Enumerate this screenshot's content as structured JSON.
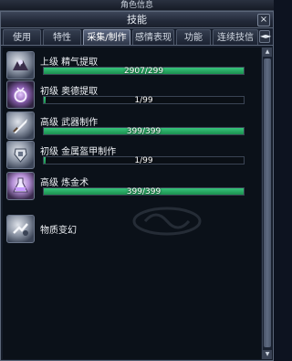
{
  "outer_title": "角色信息",
  "window": {
    "title": "技能",
    "close_symbol": "×"
  },
  "tabs": [
    {
      "label": "使用",
      "active": false
    },
    {
      "label": "特性",
      "active": false
    },
    {
      "label": "采集/制作",
      "active": true
    },
    {
      "label": "感情表现",
      "active": false
    },
    {
      "label": "功能",
      "active": false
    },
    {
      "label": "连续技信息",
      "active": false
    }
  ],
  "tab_scroll_symbol": "◄►",
  "skills": [
    {
      "name": "上级 精气提取",
      "progress_text": "2907/299",
      "progress": 1.0,
      "icon": "hands-extract-icon"
    },
    {
      "name": "初级 奥德提取",
      "progress_text": "1/99",
      "progress": 0.01,
      "icon": "amulet-icon"
    },
    {
      "name": "高级 武器制作",
      "progress_text": "399/399",
      "progress": 1.0,
      "icon": "sword-forge-icon"
    },
    {
      "name": "初级 金属盔甲制作",
      "progress_text": "1/99",
      "progress": 0.01,
      "icon": "armor-forge-icon"
    },
    {
      "name": "高级 炼金术",
      "progress_text": "399/399",
      "progress": 1.0,
      "icon": "potion-icon"
    },
    {
      "name": "物质变幻",
      "progress_text": "",
      "progress": null,
      "icon": "transform-hand-icon"
    }
  ],
  "colors": {
    "progress_fill": "#2cb06a",
    "accent_tab": "#5b6680"
  }
}
